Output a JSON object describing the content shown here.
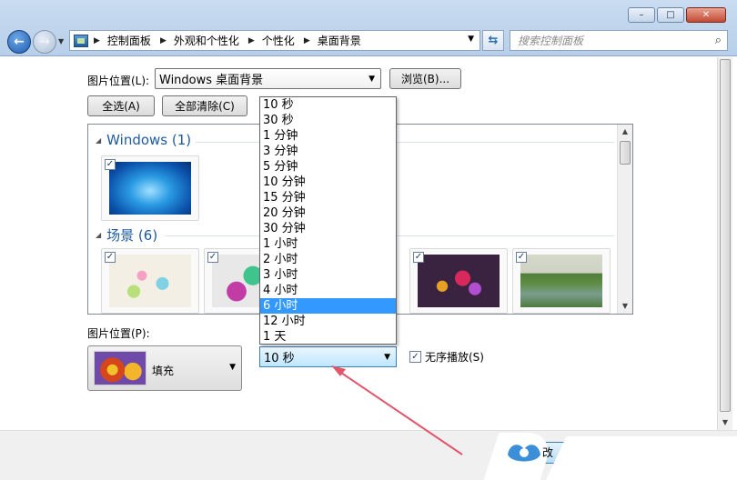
{
  "address": {
    "crumbs": [
      "控制面板",
      "外观和个性化",
      "个性化",
      "桌面背景"
    ],
    "search_placeholder": "搜索控制面板"
  },
  "picture_location": {
    "label": "图片位置(L):",
    "value": "Windows 桌面背景",
    "browse_label": "浏览(B)..."
  },
  "buttons": {
    "select_all": "全选(A)",
    "clear_all": "全部清除(C)"
  },
  "groups": [
    {
      "title": "Windows (1)"
    },
    {
      "title": "场景 (6)"
    }
  ],
  "picture_position": {
    "label": "图片位置(P):",
    "value": "填充"
  },
  "interval": {
    "value": "10 秒",
    "options": [
      "10 秒",
      "30 秒",
      "1 分钟",
      "3 分钟",
      "5 分钟",
      "10 分钟",
      "15 分钟",
      "20 分钟",
      "30 分钟",
      "1 小时",
      "2 小时",
      "3 小时",
      "4 小时",
      "6 小时",
      "12 小时",
      "1 天"
    ],
    "highlighted": "6 小时"
  },
  "shuffle": {
    "label": "无序播放(S)",
    "checked": true
  },
  "footer": {
    "save_label": "改"
  },
  "window_controls": {
    "minimize": "–",
    "maximize": "□",
    "close": "✕"
  },
  "colors": {
    "selection": "#3399ff",
    "annotation_arrow": "#e0566a",
    "group_title": "#1e5a9e"
  }
}
